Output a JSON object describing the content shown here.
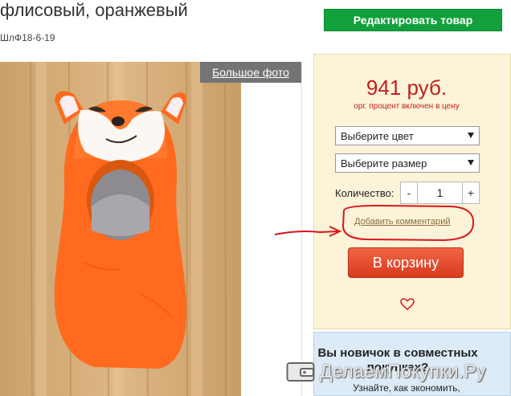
{
  "product": {
    "title": "флисовый, оранжевый",
    "sku": "ШлФ18-6-19"
  },
  "actions": {
    "edit_label": "Редактировать товар",
    "big_photo_label": "Большое фото"
  },
  "buy_box": {
    "price": "941 руб.",
    "price_note": "орг. процент включен в цену",
    "color_select": "Выберите цвет",
    "size_select": "Выберите размер",
    "quantity_label": "Количество:",
    "quantity_minus": "-",
    "quantity_value": "1",
    "quantity_plus": "+",
    "comment_link": "Добавить комментарий",
    "cart_label": "В корзину"
  },
  "newbie": {
    "title": "Вы новичок в совместных покупках?",
    "subtitle": "Узнайте, как экономить,"
  },
  "watermark": "ДелаемПокупки.Ру",
  "colors": {
    "green": "#12a03c",
    "price_red": "#c0201e",
    "cart_orange": "#e24a2a",
    "panel_bg": "#fcf3d9",
    "annotation_red": "#d8161b"
  },
  "icons": [
    "heart-icon",
    "wallet-icon"
  ]
}
